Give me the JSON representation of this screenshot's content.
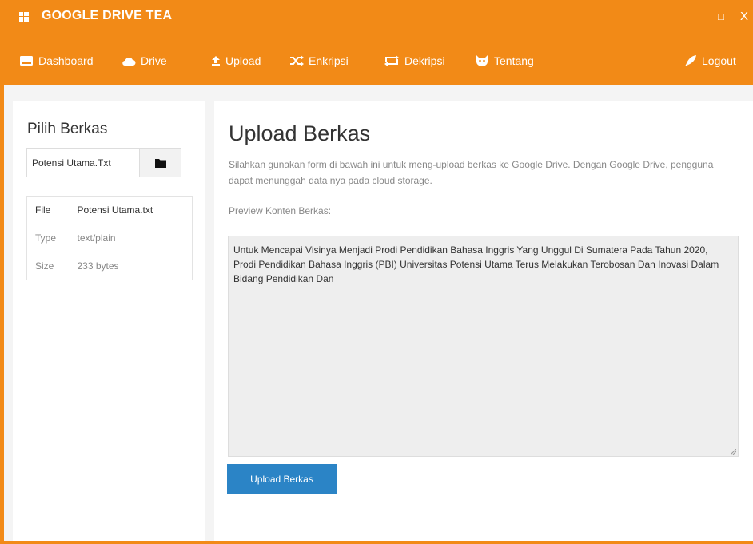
{
  "window": {
    "title": "GOOGLE DRIVE TEA",
    "controls": {
      "minimize": "_",
      "maximize": "□",
      "close": "X"
    }
  },
  "nav": {
    "items": [
      {
        "label": "Dashboard",
        "icon": "dashboard-icon"
      },
      {
        "label": "Drive",
        "icon": "cloud-icon"
      },
      {
        "label": "Upload",
        "icon": "upload-icon"
      },
      {
        "label": "Enkripsi",
        "icon": "shuffle-icon"
      },
      {
        "label": "Dekripsi",
        "icon": "repeat-icon"
      },
      {
        "label": "Tentang",
        "icon": "github-cat-icon"
      }
    ],
    "logout": {
      "label": "Logout",
      "icon": "rocket-icon"
    }
  },
  "left": {
    "title": "Pilih Berkas",
    "file_input_value": "Potensi Utama.Txt",
    "browse_icon": "folder-icon",
    "info": [
      {
        "key": "File",
        "value": "Potensi Utama.txt"
      },
      {
        "key": "Type",
        "value": "text/plain"
      },
      {
        "key": "Size",
        "value": "233 bytes"
      }
    ]
  },
  "main": {
    "title": "Upload Berkas",
    "description": "Silahkan gunakan form di bawah ini untuk meng-upload berkas ke Google Drive. Dengan Google Drive, pengguna dapat menunggah data nya pada cloud storage.",
    "preview_label": "Preview Konten Berkas:",
    "preview_content": "Untuk Mencapai Visinya Menjadi Prodi Pendidikan Bahasa Inggris Yang Unggul Di Sumatera Pada Tahun 2020, Prodi Pendidikan Bahasa Inggris (PBI) Universitas Potensi Utama Terus Melakukan Terobosan Dan Inovasi Dalam Bidang Pendidikan Dan",
    "upload_button": "Upload Berkas"
  },
  "colors": {
    "accent": "#f28a17",
    "primary_button": "#2b84c6"
  }
}
